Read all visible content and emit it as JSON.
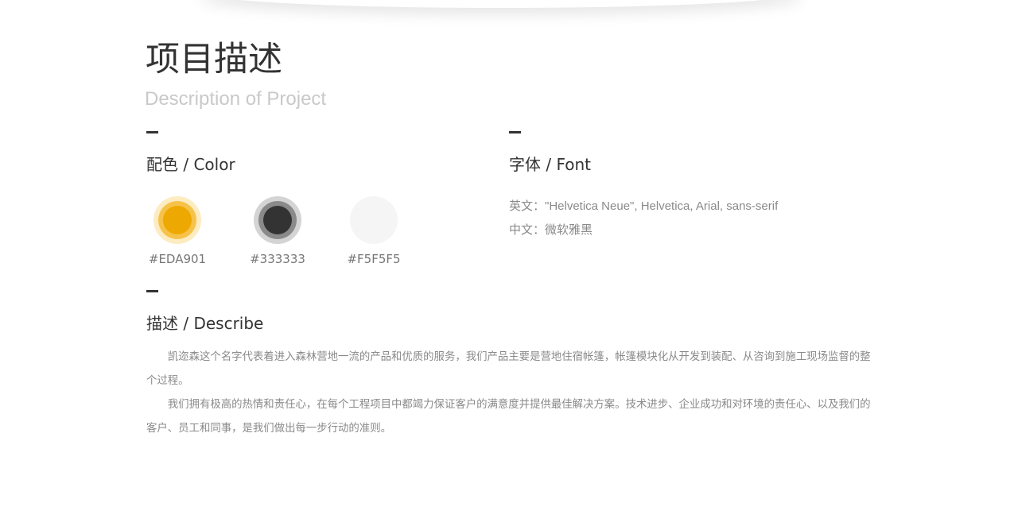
{
  "header": {
    "title": "项目描述",
    "subtitle": "Description of Project"
  },
  "color_section": {
    "title": "配色 / Color",
    "swatches": [
      {
        "label": "#EDA901",
        "outer": "#fdecc2",
        "mid": "#f6c24a",
        "inner": "#eda901"
      },
      {
        "label": "#333333",
        "outer": "#d4d4d4",
        "mid": "#8a8a8a",
        "inner": "#333333"
      },
      {
        "label": "#F5F5F5",
        "outer": "#f5f5f5",
        "mid": "#f5f5f5",
        "inner": "#f5f5f5"
      }
    ]
  },
  "font_section": {
    "title": "字体 / Font",
    "english": "英文：\"Helvetica Neue\", Helvetica, Arial, sans-serif",
    "chinese": "中文：微软雅黑"
  },
  "describe_section": {
    "title": "描述 / Describe",
    "paragraphs": [
      "凯迩森这个名字代表着进入森林营地一流的产品和优质的服务，我们产品主要是营地住宿帐篷，帐篷模块化从开发到装配、从咨询到施工现场监督的整个过程。",
      "我们拥有极高的热情和责任心，在每个工程项目中都竭力保证客户的满意度并提供最佳解决方案。技术进步、企业成功和对环境的责任心、以及我们的客户、员工和同事，是我们做出每一步行动的准则。"
    ]
  },
  "colors": {
    "accent": "#EDA901",
    "dark": "#333333",
    "light": "#F5F5F5"
  }
}
